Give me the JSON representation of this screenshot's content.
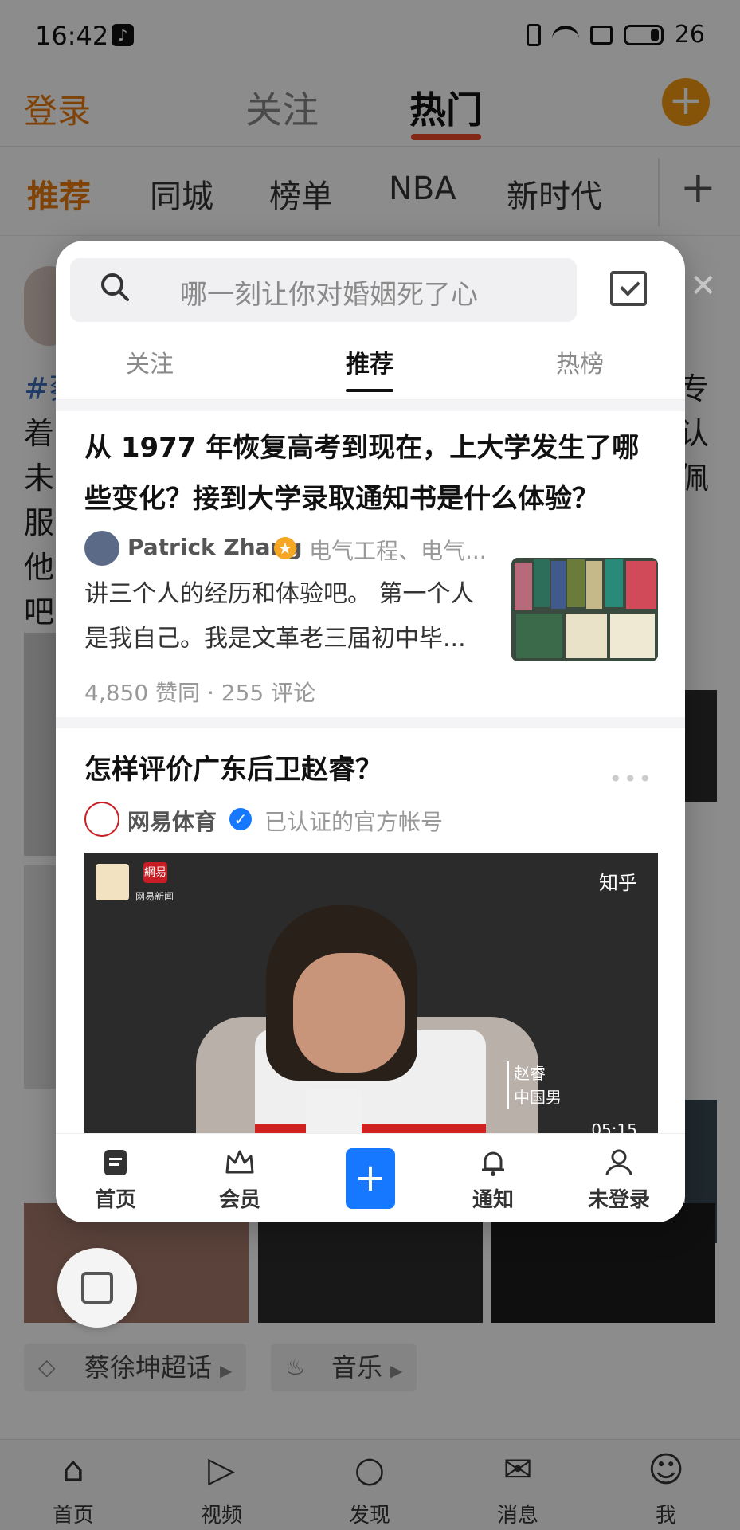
{
  "status_bar": {
    "time": "16:42",
    "battery": "26"
  },
  "weibo": {
    "login": "登录",
    "tabs": [
      "关注",
      "热门"
    ],
    "channels": [
      "推荐",
      "同城",
      "榜单",
      "NBA",
      "新时代"
    ],
    "add_channel": "+",
    "post_lines": [
      "#蔡",
      "着",
      "未",
      "服",
      "他",
      "吧"
    ],
    "post_lines_right": [
      "专",
      "认",
      "佩"
    ],
    "tags": [
      "蔡徐坤超话",
      "音乐"
    ],
    "bottom_nav": [
      "首页",
      "视频",
      "发现",
      "消息",
      "我"
    ]
  },
  "zhihu": {
    "search_placeholder": "哪一刻让你对婚姻死了心",
    "tabs": [
      "关注",
      "推荐",
      "热榜"
    ],
    "card1": {
      "title": "从 1977 年恢复高考到现在，上大学发生了哪些变化？接到大学录取通知书是什么体验？",
      "author": "Patrick Zhang",
      "author_desc": "电气工程、电气...",
      "excerpt": "讲三个人的经历和体验吧。 第一个人是我自己。我是文革老三届初中毕...",
      "meta": "4,850 赞同 · 255 评论",
      "more": "•••"
    },
    "card2": {
      "title": "怎样评价广东后卫赵睿？",
      "author": "网易体育",
      "author_desc": "已认证的官方帐号",
      "watermark": "知乎",
      "logo_text": "網易",
      "logo_sub": "网易新闻",
      "caption": "赵睿\n中国男",
      "time": "05:15"
    },
    "tabbar": [
      "首页",
      "会员",
      "通知",
      "未登录"
    ]
  }
}
